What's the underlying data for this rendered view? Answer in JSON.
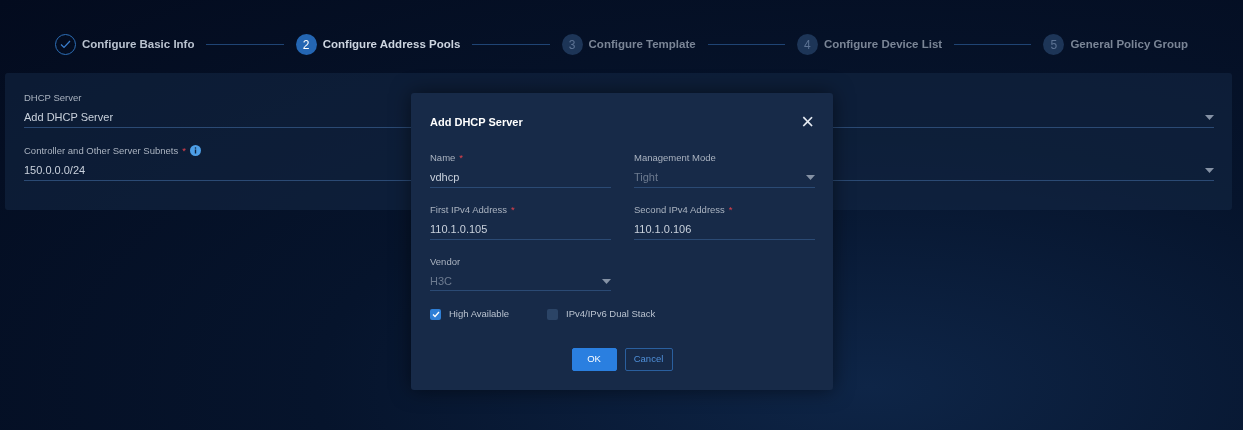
{
  "steps": [
    {
      "label": "Configure Basic Info",
      "completed": true,
      "selected": false
    },
    {
      "number": "2",
      "label": "Configure Address Pools",
      "completed": false,
      "selected": true
    },
    {
      "number": "3",
      "label": "Configure Template",
      "completed": false,
      "selected": false
    },
    {
      "number": "4",
      "label": "Configure Device List",
      "completed": false,
      "selected": false
    },
    {
      "number": "5",
      "label": "General Policy Group",
      "completed": false,
      "selected": false
    }
  ],
  "form": {
    "fields": [
      {
        "label": "DHCP Server",
        "value": "Add DHCP Server",
        "kind": "select"
      },
      {
        "label": "Controller and Other Server Subnets",
        "required_mark": "*",
        "info": true,
        "value": "150.0.0.0/24",
        "kind": "select"
      }
    ]
  },
  "dialog": {
    "title": "Add DHCP Server",
    "close": "×",
    "fields": [
      {
        "label": "Name",
        "required_mark": "*",
        "value": "vdhcp",
        "kind": "text",
        "disabled": false
      },
      {
        "label": "Management Mode",
        "value": "Tight",
        "kind": "select",
        "disabled": true
      },
      {
        "label": "First IPv4 Address",
        "required_mark": "*",
        "value": "110.1.0.105",
        "kind": "text",
        "disabled": false
      },
      {
        "label": "Second IPv4 Address",
        "required_mark": "*",
        "value": "110.1.0.106",
        "kind": "text",
        "disabled": false
      },
      {
        "label": "Vendor",
        "value": "H3C",
        "kind": "select",
        "disabled": true
      }
    ],
    "checkboxes": [
      {
        "label": "High Available",
        "checked": true
      },
      {
        "label": "IPv4/IPv6 Dual Stack",
        "checked": false
      }
    ],
    "buttons": [
      {
        "label": "OK",
        "kind": "primary"
      },
      {
        "label": "Cancel",
        "kind": "secondary"
      }
    ]
  }
}
